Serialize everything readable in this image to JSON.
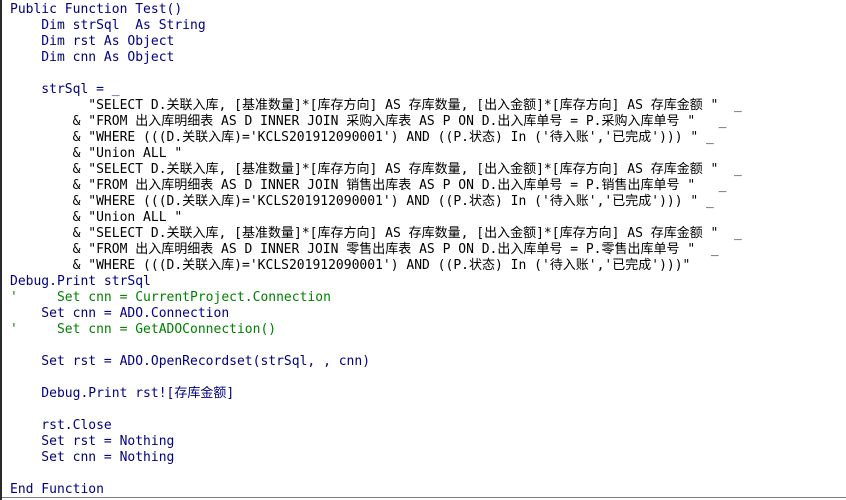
{
  "editor": {
    "title": "VBA Code Editor",
    "language": "VBA",
    "colors": {
      "background": "#ffffff",
      "code": "#000080",
      "string": "#000000",
      "comment": "#008000",
      "border": "#2b2b2b",
      "rule": "#808080"
    }
  },
  "code_lines": [
    {
      "kind": "code",
      "text": "Public Function Test()"
    },
    {
      "kind": "code",
      "text": "    Dim strSql  As String"
    },
    {
      "kind": "code",
      "text": "    Dim rst As Object"
    },
    {
      "kind": "code",
      "text": "    Dim cnn As Object"
    },
    {
      "kind": "blank",
      "text": ""
    },
    {
      "kind": "code",
      "text": "    strSql = _"
    },
    {
      "kind": "str",
      "text": "          \"SELECT D.关联入库, [基准数量]*[库存方向] AS 存库数量, [出入金额]*[库存方向] AS 存库金额 \"  _"
    },
    {
      "kind": "str",
      "text": "        & \"FROM 出入库明细表 AS D INNER JOIN 采购入库表 AS P ON D.出入库单号 = P.采购入库单号 \"   _"
    },
    {
      "kind": "str",
      "text": "        & \"WHERE (((D.关联入库)='KCLS201912090001') AND ((P.状态) In ('待入账','已完成'))) \" _"
    },
    {
      "kind": "str",
      "text": "        & \"Union ALL \""
    },
    {
      "kind": "str",
      "text": "        & \"SELECT D.关联入库, [基准数量]*[库存方向] AS 存库数量, [出入金额]*[库存方向] AS 存库金额 \"  _"
    },
    {
      "kind": "str",
      "text": "        & \"FROM 出入库明细表 AS D INNER JOIN 销售出库表 AS P ON D.出入库单号 = P.销售出库单号 \"   _"
    },
    {
      "kind": "str",
      "text": "        & \"WHERE (((D.关联入库)='KCLS201912090001') AND ((P.状态) In ('待入账','已完成'))) \" _"
    },
    {
      "kind": "str",
      "text": "        & \"Union ALL \""
    },
    {
      "kind": "str",
      "text": "        & \"SELECT D.关联入库, [基准数量]*[库存方向] AS 存库数量, [出入金额]*[库存方向] AS 存库金额 \"  _"
    },
    {
      "kind": "str",
      "text": "        & \"FROM 出入库明细表 AS D INNER JOIN 零售出库表 AS P ON D.出入库单号 = P.零售出库单号 \"  _"
    },
    {
      "kind": "str",
      "text": "        & \"WHERE (((D.关联入库)='KCLS201912090001') AND ((P.状态) In ('待入账','已完成')))\""
    },
    {
      "kind": "code",
      "text": "Debug.Print strSql"
    },
    {
      "kind": "cmt",
      "text": "'     Set cnn = CurrentProject.Connection"
    },
    {
      "kind": "code",
      "text": "    Set cnn = ADO.Connection"
    },
    {
      "kind": "cmt",
      "text": "'     Set cnn = GetADOConnection()"
    },
    {
      "kind": "blank",
      "text": ""
    },
    {
      "kind": "code",
      "text": "    Set rst = ADO.OpenRecordset(strSql, , cnn)"
    },
    {
      "kind": "blank",
      "text": ""
    },
    {
      "kind": "code",
      "text": "    Debug.Print rst![存库金额]"
    },
    {
      "kind": "blank",
      "text": ""
    },
    {
      "kind": "code",
      "text": "    rst.Close"
    },
    {
      "kind": "code",
      "text": "    Set rst = Nothing"
    },
    {
      "kind": "code",
      "text": "    Set cnn = Nothing"
    },
    {
      "kind": "blank",
      "text": ""
    },
    {
      "kind": "code",
      "text": "End Function"
    }
  ]
}
